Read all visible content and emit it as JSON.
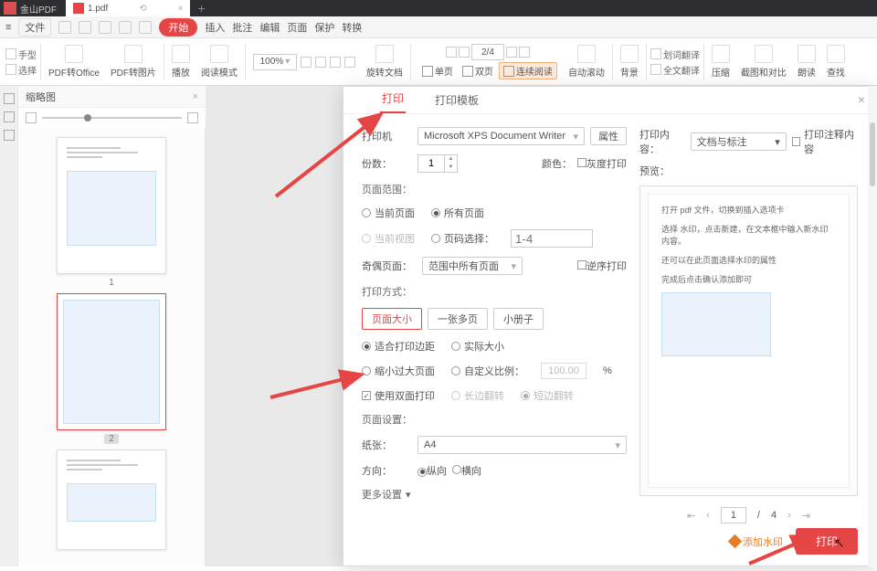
{
  "app_name": "金山PDF",
  "tab_label": "1.pdf",
  "menu": {
    "file": "文件",
    "start": "开始",
    "insert": "插入",
    "annotate": "批注",
    "edit": "编辑",
    "page": "页面",
    "protect": "保护",
    "convert": "转换"
  },
  "toolbar": {
    "hand": "手型",
    "select": "选择",
    "pdf2office": "PDF转Office",
    "pdf2image": "PDF转图片",
    "play": "播放",
    "readmode": "阅读模式",
    "zoom": "100%",
    "rotate": "旋转文档",
    "page_display": "2/4",
    "single": "单页",
    "double": "双页",
    "continuous": "连续阅读",
    "autoscroll": "自动滚动",
    "background": "背景",
    "trans_sel": "划词翻译",
    "trans_full": "全文翻译",
    "compress": "压缩",
    "compare": "截图和对比",
    "readaloud": "朗读",
    "lookup": "查找"
  },
  "thumb_title": "缩略图",
  "thumb_pages": [
    "1",
    "2"
  ],
  "dialog": {
    "tab_print": "打印",
    "tab_template": "打印模板",
    "printer_label": "打印机",
    "printer_value": "Microsoft XPS Document Writer",
    "props": "属性",
    "copies_label": "份数：",
    "copies_value": "1",
    "color_label": "颜色：",
    "grayscale": "灰度打印",
    "range_title": "页面范围：",
    "current_page": "当前页面",
    "all_pages": "所有页面",
    "current_view": "当前视图",
    "page_select": "页码选择：",
    "page_select_ph": "1-4",
    "odd_even_label": "奇偶页面：",
    "odd_even_value": "范围中所有页面",
    "reverse": "逆序打印",
    "method_title": "打印方式：",
    "fit_page": "页面大小",
    "multi": "一张多页",
    "booklet": "小册子",
    "fit_margin": "适合打印边距",
    "actual_size": "实际大小",
    "shrink": "缩小过大页面",
    "custom_scale": "自定义比例：",
    "scale_value": "100.00",
    "percent": "%",
    "duplex": "使用双面打印",
    "long_edge": "长边翻转",
    "short_edge": "短边翻转",
    "page_setup_title": "页面设置：",
    "paper_label": "纸张：",
    "paper_value": "A4",
    "orient_label": "方向：",
    "portrait": "纵向",
    "landscape": "横向",
    "more": "更多设置",
    "content_label": "打印内容：",
    "content_value": "文档与标注",
    "print_annot": "打印注释内容",
    "preview_label": "预览：",
    "preview_lines": [
      "打开 pdf 文件，切换到插入选项卡",
      "选择 水印，点击新建，在文本框中输入新水印内容。",
      "还可以在此页面选择水印的属性",
      "完成后点击确认添加即可"
    ],
    "pager_current": "1",
    "pager_total": "4",
    "watermark": "添加水印",
    "print_btn": "打印"
  }
}
